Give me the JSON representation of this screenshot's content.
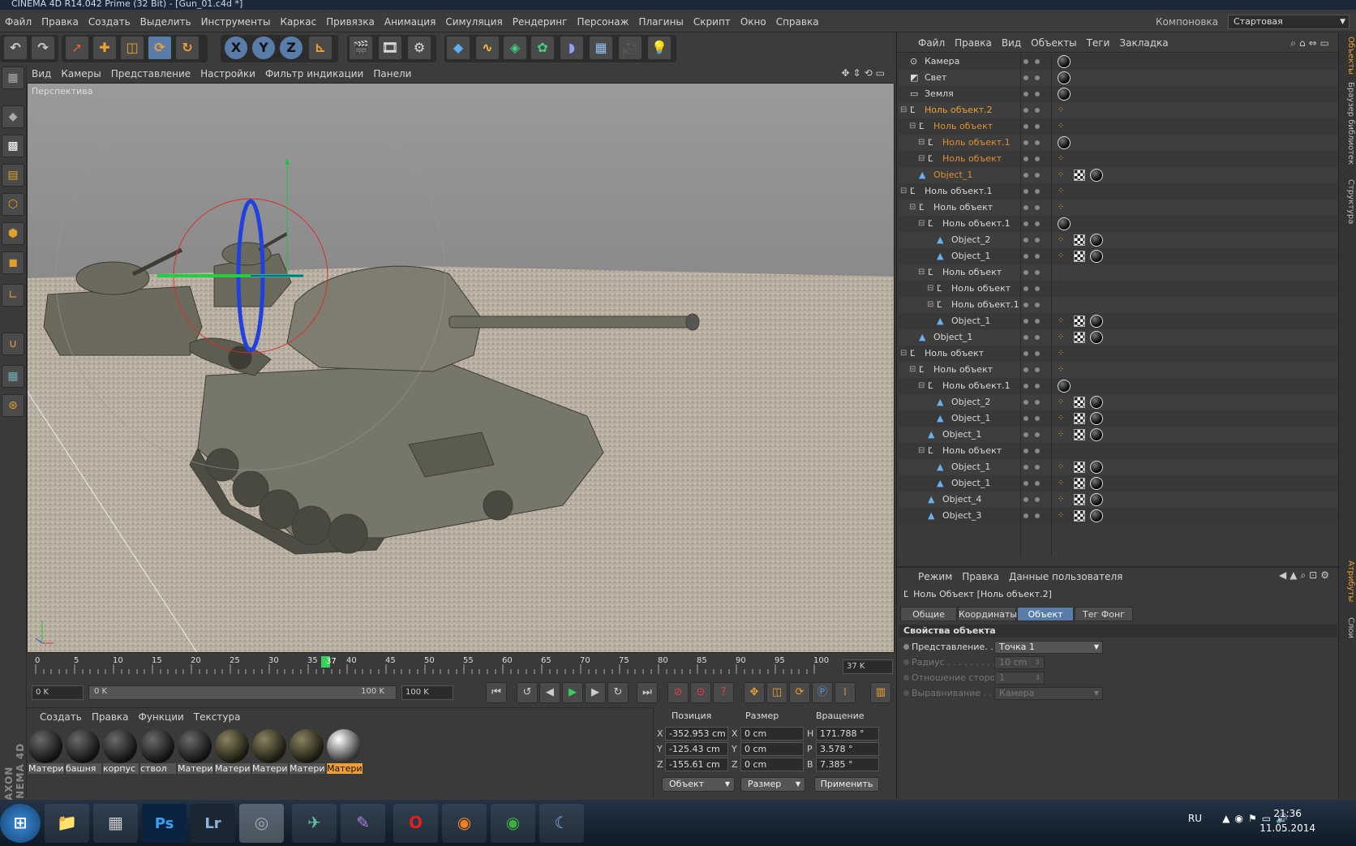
{
  "window": {
    "title": "CINEMA 4D R14.042 Prime (32 Bit) - [Gun_01.c4d *]"
  },
  "menu": {
    "items": [
      "Файл",
      "Правка",
      "Создать",
      "Выделить",
      "Инструменты",
      "Каркас",
      "Привязка",
      "Анимация",
      "Симуляция",
      "Рендеринг",
      "Персонаж",
      "Плагины",
      "Скрипт",
      "Окно",
      "Справка"
    ],
    "layout_label": "Компоновка",
    "layout_value": "Стартовая"
  },
  "toolbar": {
    "axis_x": "X",
    "axis_y": "Y",
    "axis_z": "Z",
    "icons": [
      "undo-icon",
      "redo-icon",
      "select-icon",
      "move-icon",
      "scale-icon",
      "rotate-icon",
      "recent-tool-icon",
      "axis-x-icon",
      "axis-y-icon",
      "axis-z-icon",
      "coordinate-system-icon",
      "render-view-icon",
      "render-picture-icon",
      "render-settings-icon",
      "cube-icon",
      "spline-icon",
      "nurbs-icon",
      "array-icon",
      "deformer-icon",
      "environment-icon",
      "camera-icon",
      "light-icon"
    ]
  },
  "viewport": {
    "menu": [
      "Вид",
      "Камеры",
      "Представление",
      "Настройки",
      "Фильтр индикации",
      "Панели"
    ],
    "label": "Перспектива"
  },
  "timeline": {
    "ticks": [
      "0",
      "5",
      "10",
      "15",
      "20",
      "25",
      "30",
      "35",
      "40",
      "45",
      "50",
      "55",
      "60",
      "65",
      "70",
      "75",
      "80",
      "85",
      "90",
      "95",
      "100"
    ],
    "current": "37",
    "frame_field": "37 K",
    "start": "0 K",
    "range_start": "0 K",
    "range_end": "100 K",
    "end": "100 K"
  },
  "materials": {
    "menu": [
      "Создать",
      "Правка",
      "Функции",
      "Текстура"
    ],
    "items": [
      "Матери",
      "башня",
      "корпус",
      "ствол",
      "Матери",
      "Матери",
      "Матери",
      "Матери",
      "Матери"
    ]
  },
  "coords": {
    "headers": {
      "position": "Позиция",
      "size": "Размер",
      "rotation": "Вращение"
    },
    "axes": [
      "X",
      "Y",
      "Z"
    ],
    "size_axes": [
      "X",
      "Y",
      "Z"
    ],
    "rot_axes": [
      "H",
      "P",
      "B"
    ],
    "position": [
      "-352.953 cm",
      "-125.43 cm",
      "-155.61 cm"
    ],
    "size": [
      "0 cm",
      "0 cm",
      "0 cm"
    ],
    "rotation": [
      "171.788 °",
      "3.578 °",
      "7.385 °"
    ],
    "mode_select": "Объект",
    "size_select": "Размер",
    "apply": "Применить"
  },
  "object_manager": {
    "menu": [
      "Файл",
      "Правка",
      "Вид",
      "Объекты",
      "Теги",
      "Закладка"
    ],
    "rows": [
      {
        "name": "Камера",
        "depth": 0,
        "color": "#d8d8d8",
        "tags": [
          "ball"
        ]
      },
      {
        "name": "Свет",
        "depth": 0,
        "color": "#d8d8d8",
        "tags": [
          "ball"
        ]
      },
      {
        "name": "Земля",
        "depth": 0,
        "color": "#d8d8d8",
        "tags": [
          "ball"
        ]
      },
      {
        "name": "Ноль объект.2",
        "depth": 0,
        "color": "#f0a030",
        "tags": [
          "ph"
        ]
      },
      {
        "name": "Ноль объект",
        "depth": 1,
        "color": "#e09030",
        "tags": [
          "ph"
        ]
      },
      {
        "name": "Ноль объект.1",
        "depth": 2,
        "color": "#e09030",
        "tags": [
          "ball"
        ]
      },
      {
        "name": "Ноль объект",
        "depth": 2,
        "color": "#e09030",
        "tags": [
          "ph"
        ]
      },
      {
        "name": "Object_1",
        "depth": 1,
        "color": "#e09030",
        "tags": [
          "ph",
          "chk",
          "ball"
        ]
      },
      {
        "name": "Ноль объект.1",
        "depth": 0,
        "color": "#d8d8d8",
        "tags": [
          "ph"
        ]
      },
      {
        "name": "Ноль объект",
        "depth": 1,
        "color": "#d8d8d8",
        "tags": [
          "ph"
        ]
      },
      {
        "name": "Ноль объект.1",
        "depth": 2,
        "color": "#d8d8d8",
        "tags": [
          "ball"
        ]
      },
      {
        "name": "Object_2",
        "depth": 3,
        "color": "#d8d8d8",
        "tags": [
          "ph",
          "chk",
          "ball"
        ]
      },
      {
        "name": "Object_1",
        "depth": 3,
        "color": "#d8d8d8",
        "tags": [
          "ph",
          "chk",
          "ball"
        ]
      },
      {
        "name": "Ноль объект",
        "depth": 2,
        "color": "#d8d8d8",
        "tags": []
      },
      {
        "name": "Ноль объект",
        "depth": 3,
        "color": "#d8d8d8",
        "tags": []
      },
      {
        "name": "Ноль объект.1",
        "depth": 3,
        "color": "#d8d8d8",
        "tags": []
      },
      {
        "name": "Object_1",
        "depth": 3,
        "color": "#d8d8d8",
        "tags": [
          "ph",
          "chk",
          "ball"
        ]
      },
      {
        "name": "Object_1",
        "depth": 1,
        "color": "#d8d8d8",
        "tags": [
          "ph",
          "chk",
          "ball"
        ]
      },
      {
        "name": "Ноль объект",
        "depth": 0,
        "color": "#d8d8d8",
        "tags": [
          "ph"
        ]
      },
      {
        "name": "Ноль объект",
        "depth": 1,
        "color": "#d8d8d8",
        "tags": [
          "ph"
        ]
      },
      {
        "name": "Ноль объект.1",
        "depth": 2,
        "color": "#d8d8d8",
        "tags": [
          "ball"
        ]
      },
      {
        "name": "Object_2",
        "depth": 3,
        "color": "#d8d8d8",
        "tags": [
          "ph",
          "chk",
          "ball"
        ]
      },
      {
        "name": "Object_1",
        "depth": 3,
        "color": "#d8d8d8",
        "tags": [
          "ph",
          "chk",
          "ball"
        ]
      },
      {
        "name": "Object_1",
        "depth": 2,
        "color": "#d8d8d8",
        "tags": [
          "ph",
          "chk",
          "ball"
        ]
      },
      {
        "name": "Ноль объект",
        "depth": 2,
        "color": "#d8d8d8",
        "tags": []
      },
      {
        "name": "Object_1",
        "depth": 3,
        "color": "#d8d8d8",
        "tags": [
          "ph",
          "chk",
          "ball"
        ]
      },
      {
        "name": "Object_1",
        "depth": 3,
        "color": "#d8d8d8",
        "tags": [
          "ph",
          "chk",
          "ball"
        ]
      },
      {
        "name": "Object_4",
        "depth": 2,
        "color": "#d8d8d8",
        "tags": [
          "ph",
          "chk",
          "ball"
        ]
      },
      {
        "name": "Object_3",
        "depth": 2,
        "color": "#d8d8d8",
        "tags": [
          "ph",
          "chk",
          "ball"
        ]
      }
    ]
  },
  "attributes": {
    "menu": [
      "Режим",
      "Правка",
      "Данные пользователя"
    ],
    "title": "Ноль Объект [Ноль объект.2]",
    "tabs": [
      "Общие",
      "Координаты",
      "Объект",
      "Тег Фонг"
    ],
    "active_tab": "Объект",
    "section": "Свойства объекта",
    "props": [
      {
        "label": "Представление. . . .",
        "value": "Точка 1",
        "enabled": true
      },
      {
        "label": "Радиус . . . . . . . . . .",
        "value": "10 cm",
        "enabled": false
      },
      {
        "label": "Отношение сторон",
        "value": "1",
        "enabled": false
      },
      {
        "label": "Выравнивание . . . .",
        "value": "Камера",
        "enabled": false
      }
    ]
  },
  "right_strip": [
    "Объекты",
    "Браузер библиотек",
    "Структура",
    "Атрибуты",
    "Слои"
  ],
  "left_brand": "MAXON CINEMA 4D",
  "taskbar": {
    "lang": "RU",
    "time": "21:36",
    "date": "11.05.2014",
    "apps": [
      "Ps",
      "Lr"
    ]
  }
}
